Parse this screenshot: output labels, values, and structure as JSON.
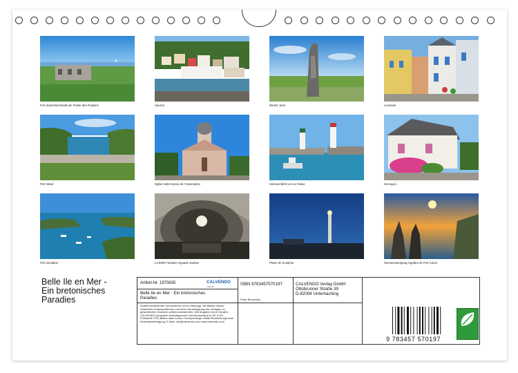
{
  "calendar": {
    "title": "Belle Ile en Mer - Ein bretonisches Paradies",
    "title_line1": "Belle Ile en Mer -",
    "title_line2": "Ein bretonisches",
    "title_line3": "Paradies"
  },
  "photos": [
    {
      "caption": "Fort Sarah-Bernhardt am Pointe des Poulains"
    },
    {
      "caption": "Sauzon"
    },
    {
      "caption": "Menhir Jean"
    },
    {
      "caption": "Locmaria"
    },
    {
      "caption": "Port Skeul"
    },
    {
      "caption": "Eglise Notre-Dame de l'Assomption"
    },
    {
      "caption": "Hafeneinfahrt von Le Palais"
    },
    {
      "caption": "Kerouyan"
    },
    {
      "caption": "Port Goulphar"
    },
    {
      "caption": "La Belle Fontaine Aiguade Vauban"
    },
    {
      "caption": "Phare de Goulphar"
    },
    {
      "caption": "Sonnenuntergang Aiguilles de Port-Coton"
    }
  ],
  "info": {
    "article_label": "Artikel-Nr. 1970635",
    "product_title_line1": "Belle Ile en Mer - Ein bretonisches",
    "product_title_line2": "Paradies",
    "legal": "Inhalte bestehender Schutzrechte ist es untersagt, die Blätter dieses Kalenders herauszutrennen und ohne Genehmigung des Verlages zu gewerblichen Zwecken weiterzuverwenden. Alle Angaben ohne Gewähr. CALVENDO produziert bedarfsgerecht und klimaneutral in DE & EU. Printwerte CO2-Bilanz dank kurzer Transportwege. Abfall-Reduzierung dank Einzelstückfertigung. E-Mail: info@calvendo.com www.calvendo.com",
    "isbn": "ISBN 9783457570197",
    "author": "Peter Benschick",
    "publisher": "CALVENDO Verlag GmbH",
    "street": "Ottobrunner Straße 39",
    "city": "D-82008 Unterhaching",
    "brand": "CALVENDO",
    "brand_sub": "Kalender",
    "barcode_number": "9 783457 570197",
    "eco_label": "eco"
  }
}
